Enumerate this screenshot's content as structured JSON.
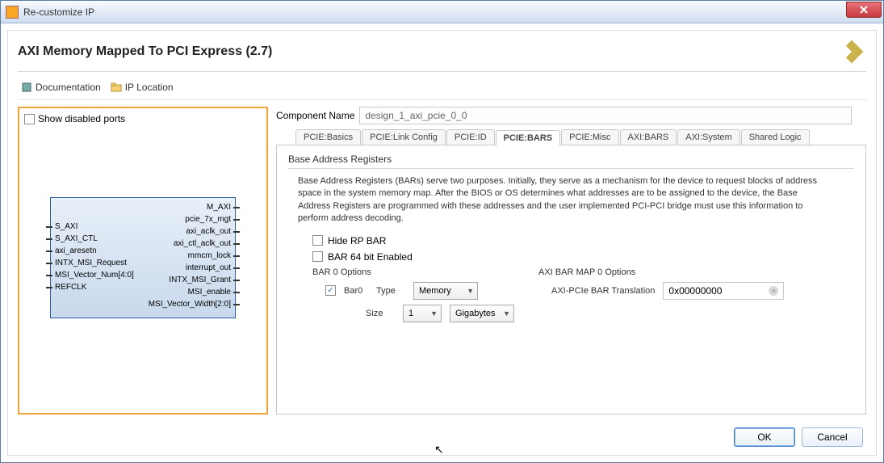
{
  "window": {
    "title": "Re-customize IP"
  },
  "dialog": {
    "title": "AXI Memory Mapped To PCI Express (2.7)"
  },
  "toolbar": {
    "doc": "Documentation",
    "iploc": "IP Location"
  },
  "left": {
    "show_disabled": "Show disabled ports",
    "ports_left": [
      "S_AXI",
      "S_AXI_CTL",
      "axi_aresetn",
      "INTX_MSI_Request",
      "MSI_Vector_Num[4:0]",
      "REFCLK"
    ],
    "ports_right": [
      "M_AXI",
      "pcie_7x_mgt",
      "axi_aclk_out",
      "axi_ctl_aclk_out",
      "mmcm_lock",
      "interrupt_out",
      "INTX_MSI_Grant",
      "MSI_enable",
      "MSI_Vector_Width[2:0]"
    ]
  },
  "component": {
    "label": "Component Name",
    "value": "design_1_axi_pcie_0_0"
  },
  "tabs": [
    "PCIE:Basics",
    "PCIE:Link Config",
    "PCIE:ID",
    "PCIE:BARS",
    "PCIE:Misc",
    "AXI:BARS",
    "AXI:System",
    "Shared Logic"
  ],
  "active_tab": "PCIE:BARS",
  "bars": {
    "section": "Base Address Registers",
    "desc": "Base Address Registers (BARs) serve two purposes. Initially, they serve as a mechanism for the device to request blocks of address space in the system memory map. After the BIOS or OS determines what addresses are to be assigned to the device, the Base Address Registers are programmed with these addresses and the user implemented PCI-PCI bridge must use this information to perform address decoding.",
    "hide_rp": "Hide RP BAR",
    "bar64": "BAR 64 bit Enabled",
    "bar0_group": "BAR 0 Options",
    "bar0_chk": "Bar0",
    "type_lbl": "Type",
    "type_val": "Memory",
    "size_lbl": "Size",
    "size_val": "1",
    "size_unit": "Gigabytes",
    "map_group": "AXI BAR MAP 0 Options",
    "trans_lbl": "AXI-PCIe BAR Translation",
    "trans_val": "0x00000000"
  },
  "buttons": {
    "ok": "OK",
    "cancel": "Cancel"
  }
}
